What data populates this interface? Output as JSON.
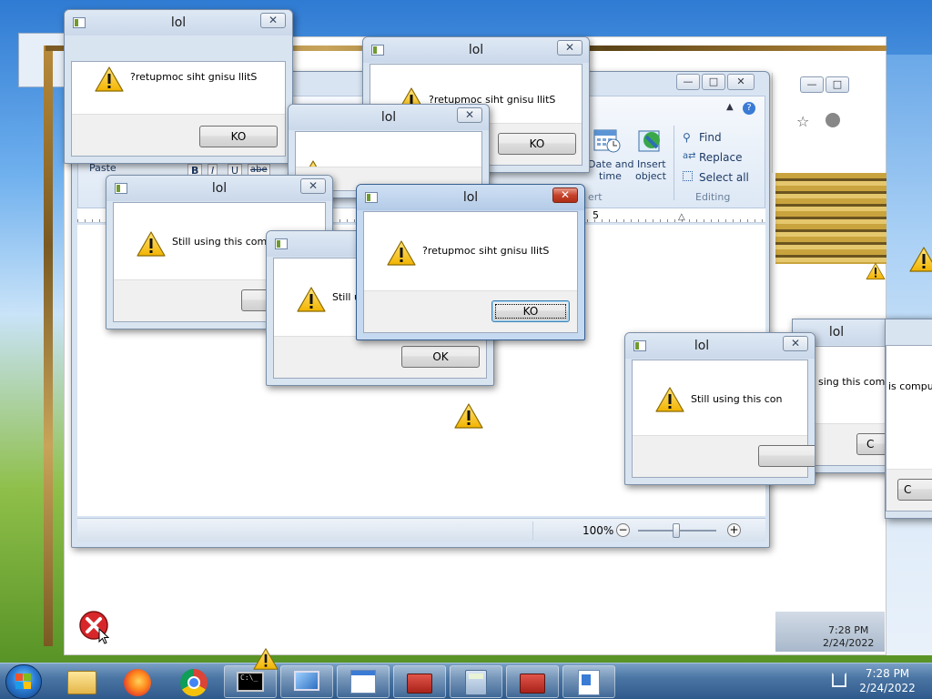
{
  "dialog_title": "lol",
  "mirrored_message": "?retupmoc siht gnisu llitS",
  "mirrored_button": "KO",
  "ok_button": "OK",
  "partial_msg_a": "Still using this comp",
  "partial_msg_b": "Still u",
  "partial_msg_c": "Still using this con",
  "partial_msg_d": "sing this compu",
  "partial_msg_e": "is compu",
  "partial_btn_c": "C",
  "partial_btn_d": "C",
  "wordpad": {
    "paste_label": "Paste",
    "bold": "B",
    "italic": "I",
    "underline": "U",
    "strike": "abe",
    "date_label_1": "Date and",
    "date_label_2": "time",
    "insert_label_1": "Insert",
    "insert_label_2": "object",
    "find": "Find",
    "replace": "Replace",
    "select_all": "Select all",
    "editing_group": "Editing",
    "insert_group_tail": "ert",
    "ruler_mark": "5",
    "zoom": "100%"
  },
  "taskbar": {
    "clock_time": "7:28 PM",
    "clock_date": "2/24/2022",
    "ghost_time": "7:28 PM",
    "ghost_date": "2/24/2022"
  },
  "icons": [
    "warning-icon",
    "error-icon",
    "start-orb-icon",
    "folder-icon",
    "firefox-icon",
    "chrome-icon",
    "cmd-icon",
    "monitor-icon",
    "wordpad-icon",
    "toolbox-icon",
    "calculator-icon"
  ],
  "colors": {
    "titlebar": "#cad8ea",
    "close_active": "#c6422a",
    "dialog_footer": "#f0f0f0",
    "taskbar": "#2e5a8c",
    "accent_blue": "#1e3a66"
  }
}
